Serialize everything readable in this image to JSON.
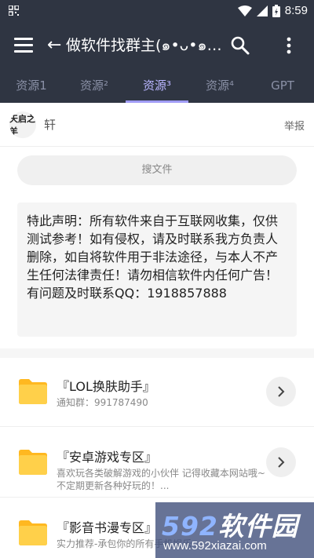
{
  "status_bar": {
    "time": "8:59"
  },
  "app_bar": {
    "back_arrow": "←",
    "title": "做软件找群主(๑•ᴗ•๑)..."
  },
  "tabs": [
    {
      "label": "资源1"
    },
    {
      "label": "资源²"
    },
    {
      "label": "资源³",
      "active": true
    },
    {
      "label": "资源⁴"
    },
    {
      "label": "GPT"
    }
  ],
  "author": {
    "avatar_text": "天启之羊",
    "name": "轩",
    "report_label": "举报"
  },
  "search": {
    "placeholder": "搜文件"
  },
  "notice": {
    "text": "特此声明：所有软件来自于互联网收集，仅供测试参考！如有侵权，请及时联系我方负责人删除，如自将软件用于非法途径，与本人不产生任何法律责任！请勿相信软件内任何广告！有问题及时联系QQ：1918857888"
  },
  "items": [
    {
      "name": "『LOL换肤助手』",
      "desc": "通知群：991787490"
    },
    {
      "name": "『安卓游戏专区』",
      "desc": "喜欢玩各类破解游戏的小伙伴 记得收藏本网站哦~不定期更新各种好玩的！..."
    },
    {
      "name": "『影音书漫专区』",
      "desc": "实力推荐-承包你的所有手机娱乐"
    }
  ],
  "watermark": {
    "logo_num": "592",
    "logo_text": "软件园",
    "url": "www.592xiazai.com"
  },
  "colors": {
    "bar": "#2f3542",
    "active_tab": "#b9b5ff",
    "folder": "#ffc93c"
  }
}
